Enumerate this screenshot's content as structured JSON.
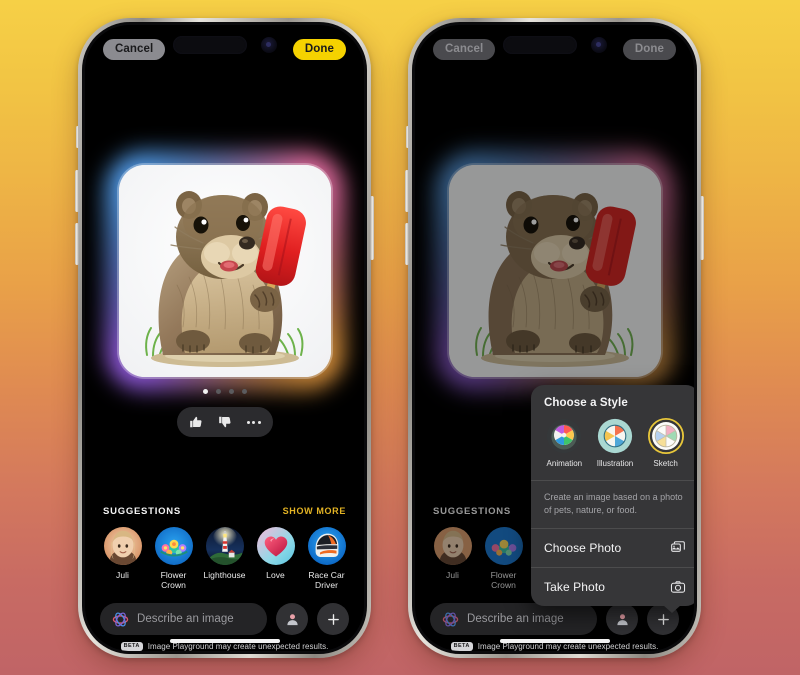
{
  "app": {
    "name": "Image Playground",
    "background_top_color": "#f6d046",
    "background_bottom_color": "#c06466"
  },
  "topbar": {
    "cancel_label": "Cancel",
    "done_label": "Done",
    "done_color": "#f5d200",
    "cancel_color": "#8b8b90"
  },
  "artwork": {
    "description": "Illustrated groundhog holding a red popsicle on grass",
    "page_dots_total": 4,
    "page_dots_active_index": 0
  },
  "feedback": {
    "thumbs_up_icon": "thumbs-up-icon",
    "thumbs_down_icon": "thumbs-down-icon",
    "more_icon": "ellipsis-icon"
  },
  "suggestions": {
    "header": "SUGGESTIONS",
    "show_more": "SHOW MORE",
    "show_more_color": "#e3b324",
    "items": [
      {
        "label": "Juli",
        "icon": "person-portrait-icon"
      },
      {
        "label": "Flower Crown",
        "icon": "flower-crown-icon"
      },
      {
        "label": "Lighthouse",
        "icon": "lighthouse-icon"
      },
      {
        "label": "Love",
        "icon": "heart-icon"
      },
      {
        "label": "Race Car Driver",
        "icon": "racing-helmet-icon"
      }
    ]
  },
  "input": {
    "placeholder": "Describe an image",
    "value": "",
    "ai_icon": "apple-intelligence-icon",
    "person_button_icon": "person-icon",
    "add_button_icon": "plus-icon"
  },
  "disclaimer": {
    "badge": "BETA",
    "text": "Image Playground may create unexpected results."
  },
  "style_popup": {
    "title": "Choose a Style",
    "styles": [
      {
        "label": "Animation",
        "icon": "beachball-animation-icon",
        "selected": false
      },
      {
        "label": "Illustration",
        "icon": "beachball-illustration-icon",
        "selected": false
      },
      {
        "label": "Sketch",
        "icon": "beachball-sketch-icon",
        "selected": true
      }
    ],
    "selected_ring_color": "#e8c73a",
    "description": "Create an image based on a photo of pets, nature, or food.",
    "actions": [
      {
        "label": "Choose Photo",
        "icon": "photo-stack-icon"
      },
      {
        "label": "Take Photo",
        "icon": "camera-icon"
      }
    ]
  }
}
